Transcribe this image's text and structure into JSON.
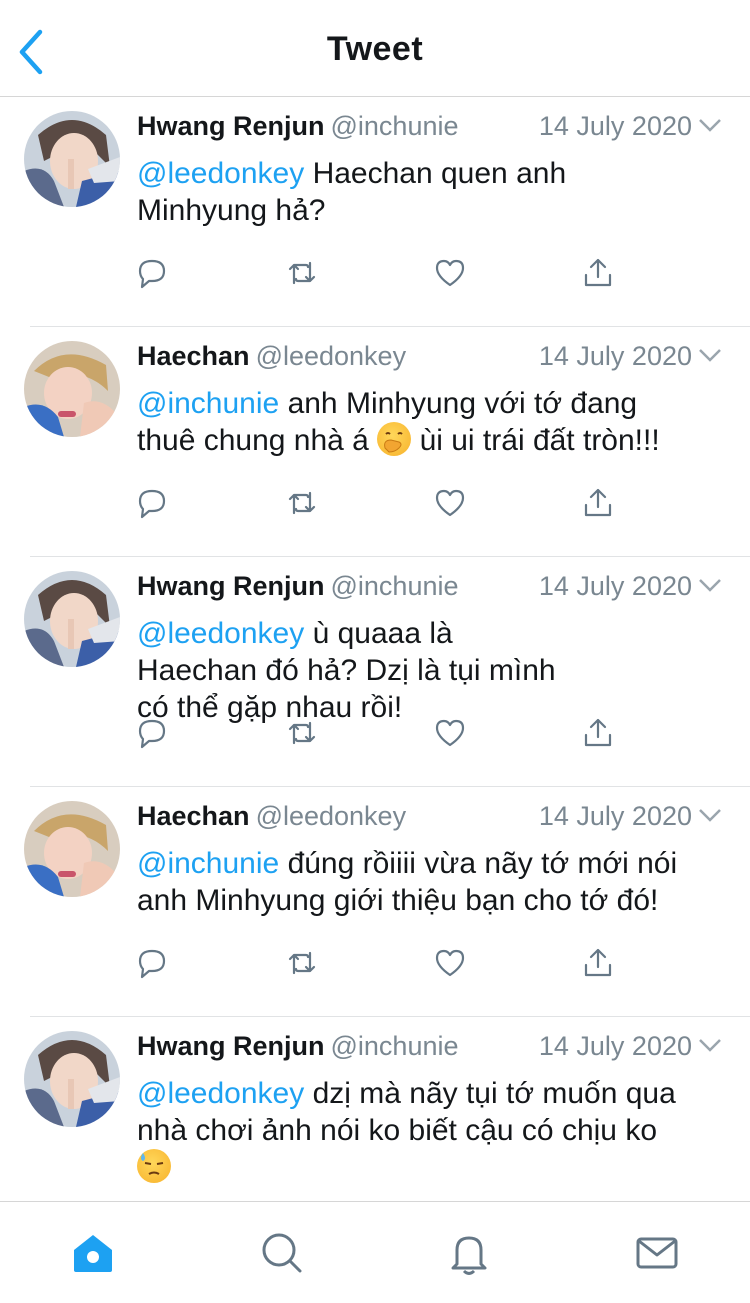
{
  "header": {
    "title": "Tweet",
    "back_icon": "chevron-left-icon"
  },
  "colors": {
    "accent": "#1da1f2",
    "muted": "#7a8791",
    "text": "#14171a"
  },
  "tweets": [
    {
      "name": "Hwang Renjun",
      "handle": "@inchunie",
      "date": "14 July 2020",
      "mention": "@leedonkey",
      "body_1": "Haechan quen anh",
      "body_2": "Minhyung hả?",
      "emoji": ""
    },
    {
      "name": "Haechan",
      "handle": "@leedonkey",
      "date": "14 July 2020",
      "mention": "@inchunie",
      "body_1": "anh Minhyung với tớ đang",
      "body_2": "thuê chung nhà á",
      "body_3": "ùi ui trái đất tròn!!!",
      "emoji": "face-with-hand-over-mouth"
    },
    {
      "name": "Hwang Renjun",
      "handle": "@inchunie",
      "date": "14 July 2020",
      "mention": "@leedonkey",
      "body_1": "ù quaaa là",
      "body_2": "Haechan đó hả? Dzị là tụi mình",
      "body_3": "có thể gặp nhau rồi!",
      "emoji": ""
    },
    {
      "name": "Haechan",
      "handle": "@leedonkey",
      "date": "14 July 2020",
      "mention": "@inchunie",
      "body_1": "đúng rồiiii vừa nãy tớ mới nói",
      "body_2": "anh Minhyung giới thiệu bạn cho tớ đó!",
      "emoji": ""
    },
    {
      "name": "Hwang Renjun",
      "handle": "@inchunie",
      "date": "14 July 2020",
      "mention": "@leedonkey",
      "body_1": "dzị mà nãy tụi tớ muốn qua",
      "body_2": "nhà chơi ảnh nói ko biết cậu có chịu ko",
      "emoji": "downcast-face-with-sweat"
    }
  ],
  "tabbar": {
    "tabs": [
      "home-icon",
      "search-icon",
      "notifications-icon",
      "messages-icon"
    ],
    "active": "home-icon"
  }
}
